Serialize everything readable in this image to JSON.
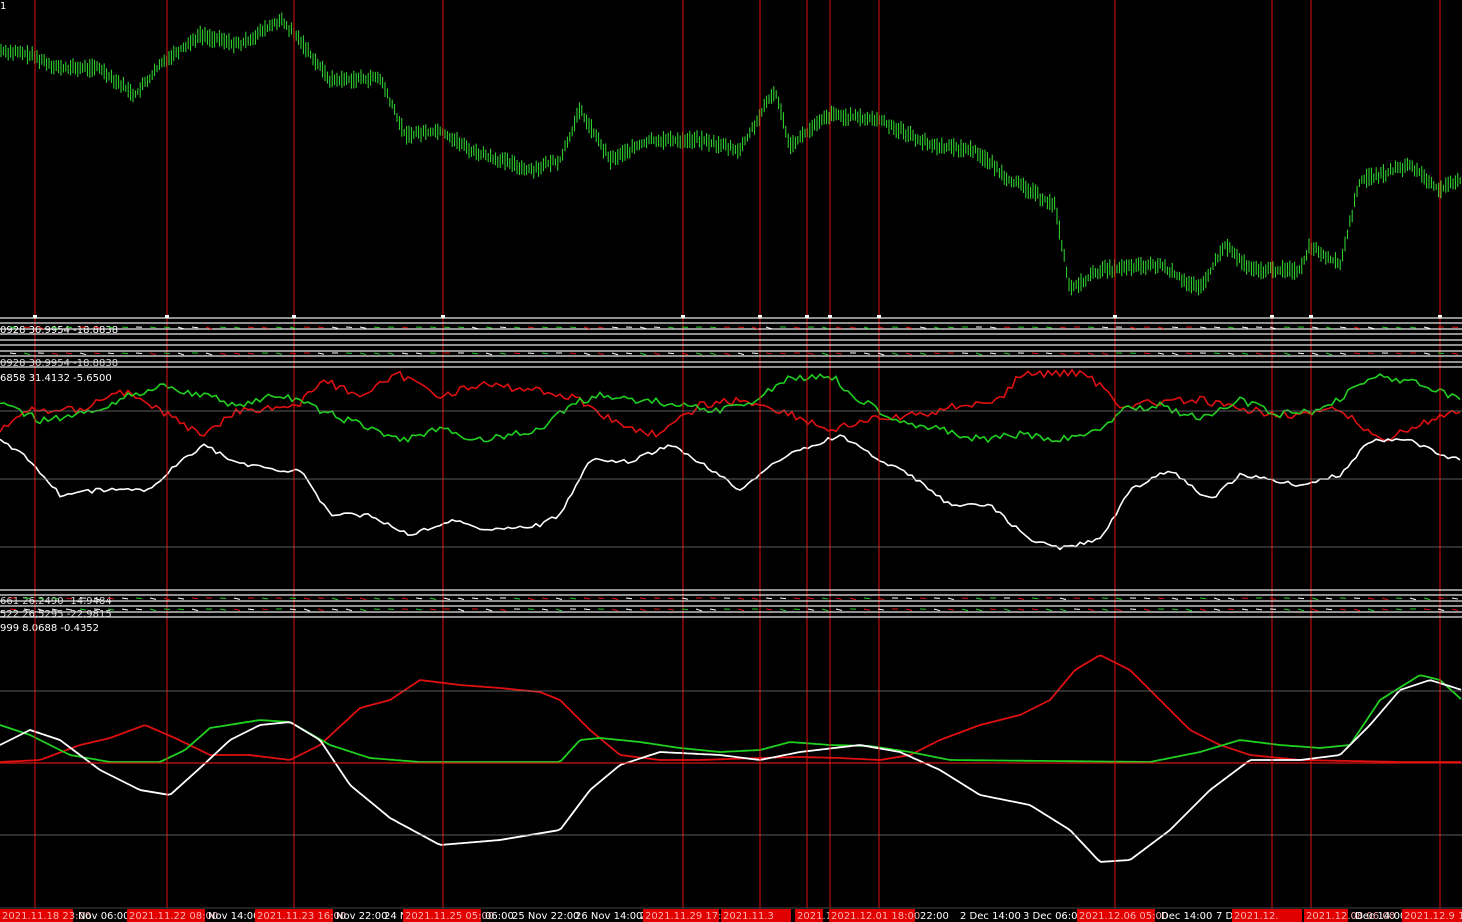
{
  "colors": {
    "background": "#000000",
    "price": "#33e033",
    "red": "#e01010",
    "green": "#20d020",
    "white": "#ffffff",
    "separator": "#e8e8e8",
    "grid": "#7a7a7a",
    "marker_bg": "#e00000"
  },
  "main_chart": {
    "title_fragment": "1"
  },
  "indicator_1": {
    "values_line": "0928 30.9954 -18.8838",
    "values_line_2": "0928 30.9954 -18.8838"
  },
  "indicator_2": {
    "values_line": "6858 31.4132 -5.6500"
  },
  "indicator_3": {
    "values_line": "661 26.2490 -14.9484",
    "values_line_2": "522 26.5295 -22.9815"
  },
  "indicator_4": {
    "values_line": "999 8.0688 -0.4352"
  },
  "time_axis": {
    "labels": [
      {
        "text": "2021.11.18 23:00",
        "highlight": true
      },
      {
        "text": "Nov 06:00",
        "highlight": false
      },
      {
        "text": "2021.11.22 08:00",
        "highlight": true
      },
      {
        "text": "Nov 14:00",
        "highlight": false
      },
      {
        "text": "2021.11.23 16:00",
        "highlight": true
      },
      {
        "text": "Nov 22:00",
        "highlight": false
      },
      {
        "text": "24 N",
        "highlight": false
      },
      {
        "text": "2021.11.25 05:00",
        "highlight": true
      },
      {
        "text": "06:00",
        "highlight": false
      },
      {
        "text": "25 Nov 22:00",
        "highlight": false
      },
      {
        "text": "26 Nov 14:00",
        "highlight": false
      },
      {
        "text": "2",
        "highlight": false
      },
      {
        "text": "2021.11.29 17:00",
        "highlight": true
      },
      {
        "text": "2021.11.3",
        "highlight": true
      },
      {
        "text": "2021.12.0",
        "highlight": true
      },
      {
        "text": "2021.12.01 18:00",
        "highlight": true
      },
      {
        "text": "22:00",
        "highlight": false
      },
      {
        "text": "2 Dec 14:00",
        "highlight": false
      },
      {
        "text": "3 Dec 06:00",
        "highlight": false
      },
      {
        "text": "2021.12.06 05:00",
        "highlight": true
      },
      {
        "text": "Dec 14:00",
        "highlight": false
      },
      {
        "text": "7 De",
        "highlight": false
      },
      {
        "text": "2021.12.",
        "highlight": true
      },
      {
        "text": "2021.12.08 06:00",
        "highlight": true
      },
      {
        "text": "Dec 14:00",
        "highlight": false
      },
      {
        "text": "2021.12.9 1",
        "highlight": true
      }
    ]
  }
}
